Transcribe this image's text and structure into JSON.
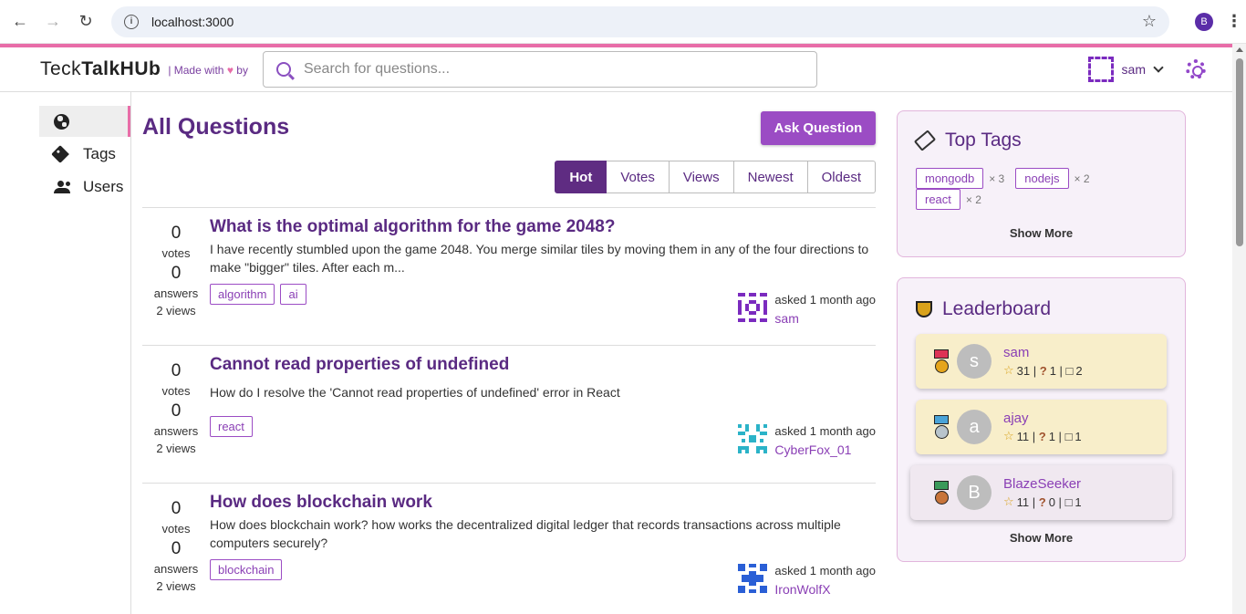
{
  "browser": {
    "url": "localhost:3000",
    "profile_initial": "B"
  },
  "header": {
    "logo_regular": "Teck",
    "logo_bold": "TalkHUb",
    "made_with_prefix": "| Made with",
    "made_with_suffix": "by",
    "search_placeholder": "Search for questions...",
    "username": "sam"
  },
  "sidebar": {
    "items": [
      {
        "label": "",
        "icon": "globe-icon"
      },
      {
        "label": "Tags",
        "icon": "tag-icon"
      },
      {
        "label": "Users",
        "icon": "users-icon"
      }
    ]
  },
  "main": {
    "title": "All Questions",
    "ask_label": "Ask Question",
    "filters": [
      "Hot",
      "Votes",
      "Views",
      "Newest",
      "Oldest"
    ],
    "active_filter": "Hot",
    "questions": [
      {
        "votes": "0",
        "votes_label": "votes",
        "answers": "0",
        "answers_label": "answers",
        "views": "2 views",
        "title": "What is the optimal algorithm for the game 2048?",
        "excerpt": "I have recently stumbled upon the game 2048. You merge similar tiles by moving them in any of the four directions to make \"bigger\" tiles. After each m...",
        "tags": [
          "algorithm",
          "ai"
        ],
        "asked": "asked 1 month ago",
        "author": "sam",
        "avatar_color": "#7b2bbf"
      },
      {
        "votes": "0",
        "votes_label": "votes",
        "answers": "0",
        "answers_label": "answers",
        "views": "2 views",
        "title": "Cannot read properties of undefined",
        "excerpt": "How do I resolve the 'Cannot read properties of undefined' error in React",
        "tags": [
          "react"
        ],
        "asked": "asked 1 month ago",
        "author": "CyberFox_01",
        "avatar_color": "#2bb3c8"
      },
      {
        "votes": "0",
        "votes_label": "votes",
        "answers": "0",
        "answers_label": "answers",
        "views": "2 views",
        "title": "How does blockchain work",
        "excerpt": "How does blockchain work? how works the decentralized digital ledger that records transactions across multiple computers securely?",
        "tags": [
          "blockchain"
        ],
        "asked": "asked 1 month ago",
        "author": "IronWolfX",
        "avatar_color": "#2a5fd6"
      }
    ]
  },
  "top_tags": {
    "title": "Top Tags",
    "tags": [
      {
        "name": "mongodb",
        "count": "× 3"
      },
      {
        "name": "nodejs",
        "count": "× 2"
      },
      {
        "name": "react",
        "count": "× 2"
      }
    ],
    "show_more": "Show More"
  },
  "leaderboard": {
    "title": "Leaderboard",
    "users": [
      {
        "initial": "s",
        "name": "sam",
        "reputation": "31 |",
        "questions": "1 |",
        "answers": "2",
        "medal_color": "#e5a51c"
      },
      {
        "initial": "a",
        "name": "ajay",
        "reputation": "11 |",
        "questions": "1 |",
        "answers": "1",
        "medal_color": "#b8c4cc"
      },
      {
        "initial": "B",
        "name": "BlazeSeeker",
        "reputation": "11 |",
        "questions": "0 |",
        "answers": "1",
        "medal_color": "#c8743a"
      }
    ],
    "show_more": "Show More"
  },
  "colors": {
    "brand_purple": "#5a2a82",
    "accent_pink": "#e86da8",
    "button_purple": "#9b4cc4"
  }
}
